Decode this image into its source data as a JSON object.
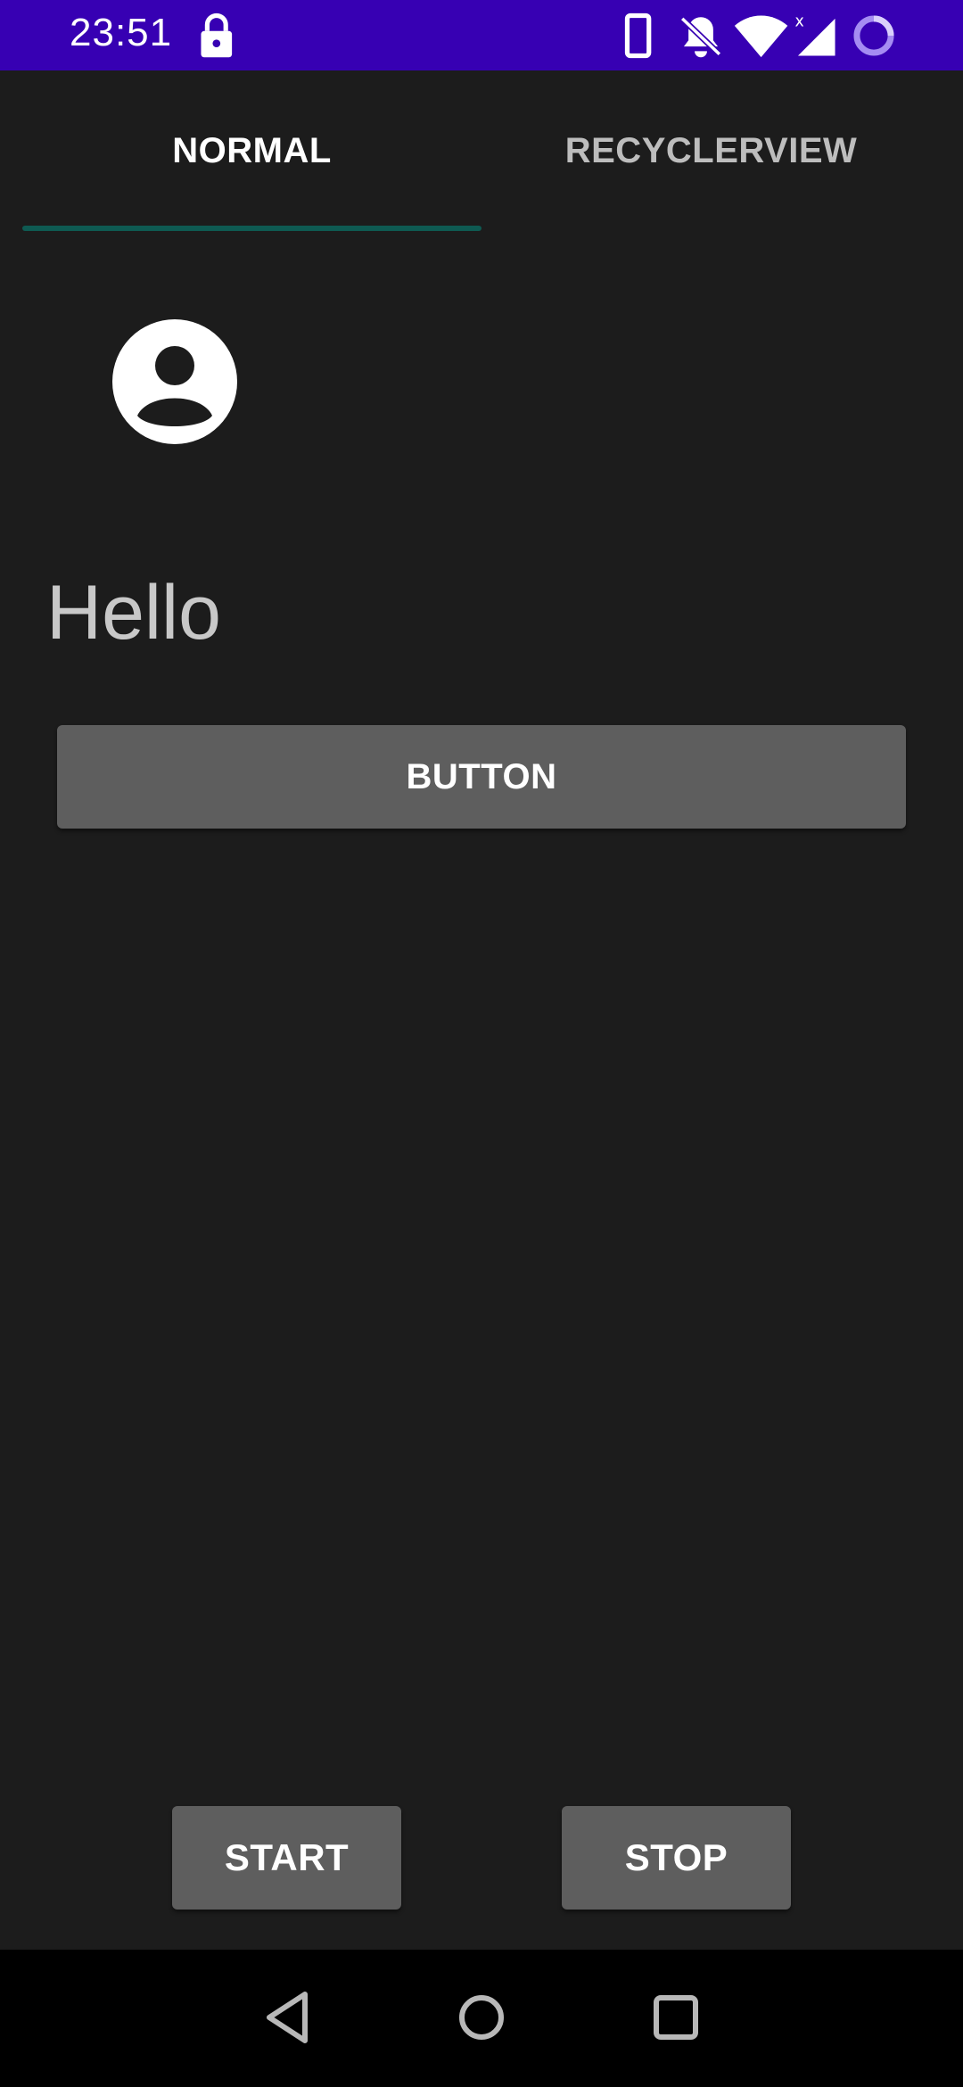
{
  "status_bar": {
    "time": "23:51",
    "background_color": "#3700b3",
    "icons": [
      "lock-icon",
      "phone-icon",
      "notifications-off-icon",
      "wifi-icon",
      "signal-icon",
      "loading-icon"
    ]
  },
  "tabs": [
    {
      "label": "NORMAL",
      "selected": true
    },
    {
      "label": "RECYCLERVIEW",
      "selected": false
    }
  ],
  "tab_indicator_color": "#0e5a52",
  "content": {
    "avatar_icon": "account-circle-icon",
    "hello_text": "Hello",
    "button_label": "BUTTON"
  },
  "bottom_buttons": {
    "start_label": "START",
    "stop_label": "STOP"
  },
  "nav_bar": {
    "icons": [
      "back-icon",
      "home-icon",
      "recents-icon"
    ]
  }
}
